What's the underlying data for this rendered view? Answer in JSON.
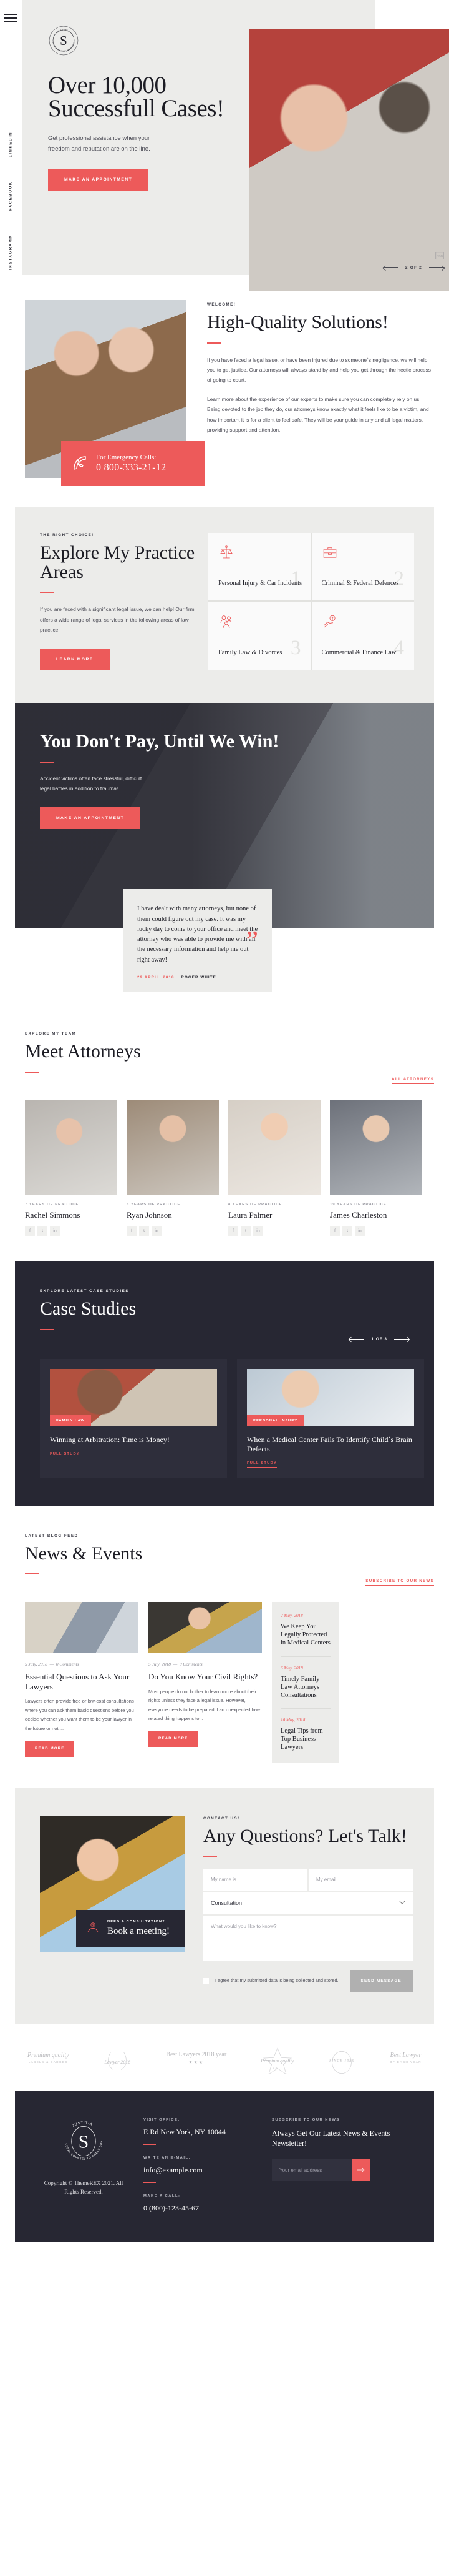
{
  "brand": {
    "logo_text_top": "JUSTITIA",
    "logo_text_ring": "LEGAL COUNSEL TO GREAT COMPANIES",
    "accent": "#ed5a5a",
    "dark": "#272733",
    "light_bg": "#ececea"
  },
  "hero": {
    "title": "Over 10,000 Successfull Cases!",
    "subtitle": "Get professional assistance when your freedom and reputation are on the line.",
    "cta": "MAKE AN APPOINTMENT",
    "slider_counter": "2 OF 2",
    "social": [
      "INSTAGRAMM",
      "FACEBOOK",
      "LINKEDIN"
    ]
  },
  "welcome": {
    "eyebrow": "WELCOME!",
    "title": "High-Quality Solutions!",
    "paragraph1": "If you have faced a legal issue, or have been injured due to someone`s negligence, we will help you to get justice. Our attorneys will always stand by and help you get through the hectic process of going to court.",
    "paragraph2": "Learn more about the experience of our experts to make sure you can completely rely on us. Being devoted to the job they do, our attorneys know exactly what it feels like to be a victim, and how important it is for a client to feel safe. They will be your guide in any and all legal matters, providing support and attention.",
    "emergency_label": "For Emergency Calls:",
    "emergency_phone": "0 800-333-21-12"
  },
  "practice": {
    "eyebrow": "THE RIGHT CHOICE!",
    "title": "Explore My Practice Areas",
    "paragraph": "If you are faced with a significant legal issue, we can help! Our firm offers a wide range of legal services in the following areas of law practice.",
    "cta": "LEARN MORE",
    "cards": [
      {
        "num": "1",
        "title": "Personal Injury & Car Incidents",
        "icon": "scales-icon"
      },
      {
        "num": "2",
        "title": "Criminal & Federal Defences",
        "icon": "briefcase-icon"
      },
      {
        "num": "3",
        "title": "Family Law & Divorces",
        "icon": "family-icon"
      },
      {
        "num": "4",
        "title": "Commercial & Finance Law",
        "icon": "money-hand-icon"
      }
    ]
  },
  "dontpay": {
    "title": "You Don't Pay, Until We Win!",
    "subtitle": "Accident victims often face stressful, difficult legal battles in addition to trauma!",
    "cta": "MAKE AN APPOINTMENT",
    "quote": "I have dealt with many attorneys, but none of them could figure out my case. It was my lucky day to come to your office and meet the attorney who was able to provide me with all the necessary information and help me out right away!",
    "quote_date": "29 APRIL, 2018",
    "quote_author": "ROGER WHITE"
  },
  "team": {
    "eyebrow": "EXPLORE MY TEAM",
    "title": "Meet Attorneys",
    "all_link": "ALL ATTORNEYS",
    "members": [
      {
        "years": "7 YEARS OF PRACTICE",
        "name": "Rachel Simmons"
      },
      {
        "years": "5 YEARS OF PRACTICE",
        "name": "Ryan Johnson"
      },
      {
        "years": "8 YEARS OF PRACTICE",
        "name": "Laura Palmer"
      },
      {
        "years": "19 YEARS OF PRACTICE",
        "name": "James Charleston"
      }
    ],
    "social_icons": [
      "f",
      "t",
      "in"
    ]
  },
  "cases": {
    "eyebrow": "EXPLORE LATEST CASE STUDIES",
    "title": "Case Studies",
    "slider_counter": "1 OF 3",
    "items": [
      {
        "tag": "FAMILY LAW",
        "title": "Winning at Arbitration: Time is Money!",
        "link": "FULL STUDY"
      },
      {
        "tag": "PERSONAL INJURY",
        "title": "When a Medical Center Fails To Identify Child`s Brain Defects",
        "link": "FULL STUDY"
      }
    ]
  },
  "news": {
    "eyebrow": "LATEST BLOG FEED",
    "title": "News & Events",
    "subscribe_link": "SUBSCRIBE TO OUR NEWS",
    "posts": [
      {
        "date": "5 July, 2018",
        "comments": "0 Comments",
        "title": "Essential Questions to Ask Your Lawyers",
        "excerpt": "Lawyers often provide free or low-cost consultations where you can ask them basic questions before you decide whether you want them to be your lawyer in the future or not....",
        "cta": "READ MORE"
      },
      {
        "date": "5 July, 2018",
        "comments": "0 Comments",
        "title": "Do You Know Your Civil Rights?",
        "excerpt": "Most people do not bother to learn more about their rights unless they face a legal issue. However, everyone needs to be prepared if an unexpected law-related thing happens to...",
        "cta": "READ MORE"
      }
    ],
    "sidebar": [
      {
        "date": "2 May, 2018",
        "title": "We Keep You Legally Protected in Medical Centers"
      },
      {
        "date": "6 May, 2018",
        "title": "Timely Family Law Attorneys Consultations"
      },
      {
        "date": "10 May, 2018",
        "title": "Legal Tips from Top Business Lawyers"
      }
    ]
  },
  "contact": {
    "eyebrow": "CONTACT US!",
    "title": "Any Questions? Let's Talk!",
    "name_placeholder": "My name is",
    "email_placeholder": "My email",
    "select_value": "Consultation",
    "message_placeholder": "What would you like to know?",
    "consent": "I agree that my submitted data is being collected and stored.",
    "send_label": "SEND MESSAGE",
    "book_eyebrow": "NEED A CONSULTATION?",
    "book_title": "Book a meeting!"
  },
  "awards": [
    {
      "line1": "Premium quality",
      "line2": "LABELS & BADGES"
    },
    {
      "line1": "Lawyer 2018",
      "line2": ""
    },
    {
      "line1": "Best Lawyers 2018 year",
      "line2": "★★★"
    },
    {
      "line1": "Premium quality",
      "line2": "EST."
    },
    {
      "line1": "SINCE 1986",
      "line2": ""
    },
    {
      "line1": "Best Lawyer",
      "line2": "OF EACH YEAR"
    }
  ],
  "footer": {
    "copyright": "Copyright © ThemeREX 2021. All Rights Reserved.",
    "office_label": "VISIT OFFICE:",
    "office_value": "E Rd New York, NY 10044",
    "email_label": "WRITE AN E-MAIL:",
    "email_value": "info@example.com",
    "phone_label": "MAKE A CALL:",
    "phone_value": "0 (800)-123-45-67",
    "subscribe_label": "SUBSCRIBE TO OUR NEWS",
    "subscribe_title": "Always Get Our Latest News & Events Newsletter!",
    "email_placeholder": "Your email address",
    "submit_icon": "arrow-right-icon"
  }
}
